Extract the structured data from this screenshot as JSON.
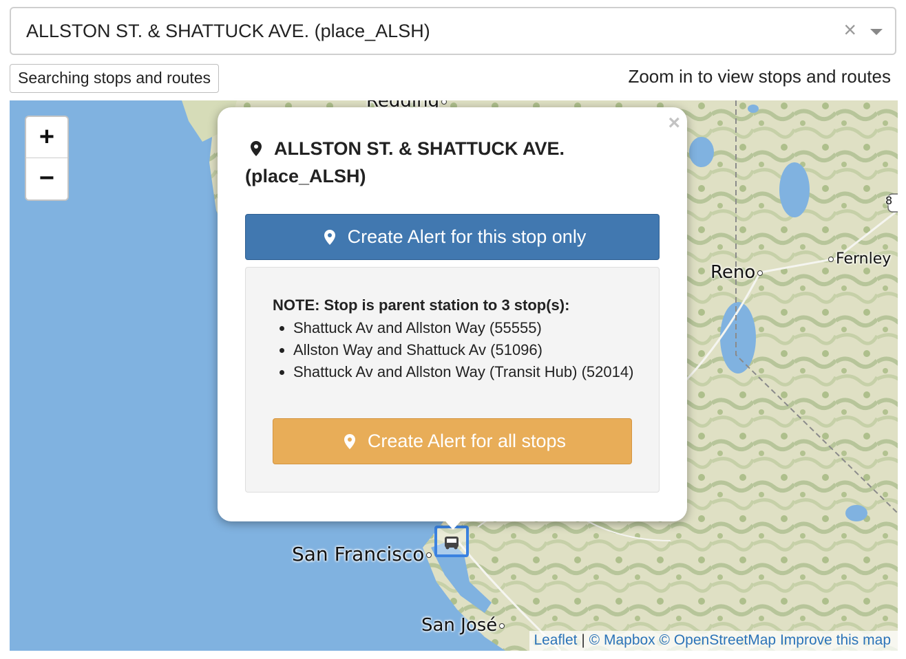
{
  "search": {
    "selected": "ALLSTON ST. & SHATTUCK AVE. (place_ALSH)",
    "clear_icon": "×",
    "toggle_label": "Searching stops and routes",
    "zoom_hint": "Zoom in to view stops and routes"
  },
  "map": {
    "zoom_in": "+",
    "zoom_out": "−",
    "cities": {
      "redding": "Redding",
      "reno": "Reno",
      "fernley": "Fernley",
      "san_francisco": "San Francisco",
      "san_jose": "San José"
    },
    "highway_shield": "8",
    "attribution": {
      "leaflet": "Leaflet",
      "separator": "|",
      "mapbox": "© Mapbox",
      "osm": "© OpenStreetMap",
      "improve": "Improve this map"
    },
    "colors": {
      "water": "#80b2e0",
      "land": "#e4e2c8",
      "terrain": "#b8c69a"
    }
  },
  "popup": {
    "close": "×",
    "title": "ALLSTON ST. & SHATTUCK AVE. (place_ALSH)",
    "create_stop_alert": "Create Alert for this stop only",
    "note_heading": "NOTE: Stop is parent station to 3 stop(s):",
    "stops": [
      "Shattuck Av and Allston Way (55555)",
      "Allston Way and Shattuck Av (51096)",
      "Shattuck Av and Allston Way (Transit Hub) (52014)"
    ],
    "create_all_alert": "Create Alert for all stops",
    "colors": {
      "primary": "#4178b0",
      "warning": "#e8ad58"
    }
  }
}
